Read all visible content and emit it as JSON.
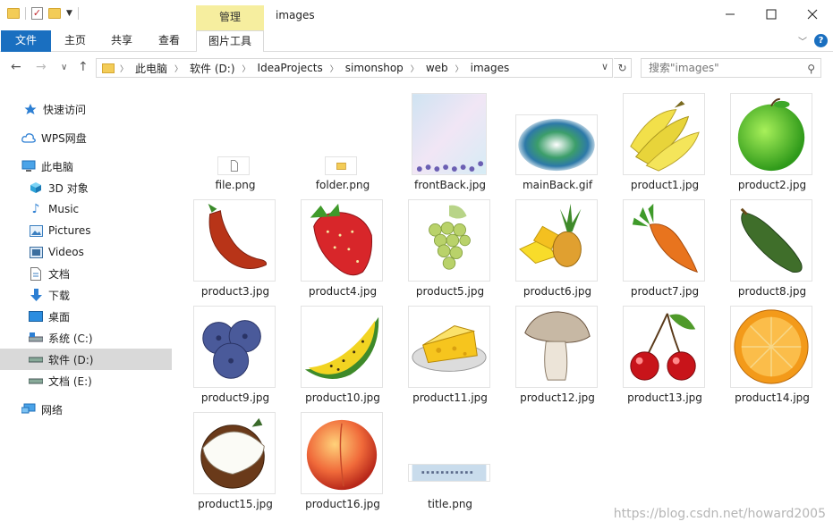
{
  "window": {
    "title": "images",
    "manage_tab": "管理"
  },
  "ribbon": {
    "tabs": [
      {
        "label": "文件"
      },
      {
        "label": "主页"
      },
      {
        "label": "共享"
      },
      {
        "label": "查看"
      },
      {
        "label": "图片工具"
      }
    ]
  },
  "address": {
    "crumbs": [
      "此电脑",
      "软件 (D:)",
      "IdeaProjects",
      "simonshop",
      "web",
      "images"
    ],
    "search_placeholder": "搜索\"images\""
  },
  "sidebar": {
    "items": [
      {
        "label": "快速访问",
        "icon": "star-icon"
      },
      {
        "label": "WPS网盘",
        "icon": "cloud-icon"
      },
      {
        "label": "此电脑",
        "icon": "computer-icon"
      },
      {
        "label": "3D 对象",
        "icon": "cube-icon"
      },
      {
        "label": "Music",
        "icon": "music-icon"
      },
      {
        "label": "Pictures",
        "icon": "pictures-icon"
      },
      {
        "label": "Videos",
        "icon": "videos-icon"
      },
      {
        "label": "文档",
        "icon": "document-icon"
      },
      {
        "label": "下载",
        "icon": "download-icon"
      },
      {
        "label": "桌面",
        "icon": "desktop-icon"
      },
      {
        "label": "系统 (C:)",
        "icon": "drive-c-icon"
      },
      {
        "label": "软件 (D:)",
        "icon": "drive-d-icon"
      },
      {
        "label": "文档 (E:)",
        "icon": "drive-e-icon"
      },
      {
        "label": "网络",
        "icon": "network-icon"
      }
    ],
    "selected_label": "软件 (D:)"
  },
  "files": [
    {
      "name": "file.png"
    },
    {
      "name": "folder.png"
    },
    {
      "name": "frontBack.jpg"
    },
    {
      "name": "mainBack.gif"
    },
    {
      "name": "product1.jpg"
    },
    {
      "name": "product2.jpg"
    },
    {
      "name": "product3.jpg"
    },
    {
      "name": "product4.jpg"
    },
    {
      "name": "product5.jpg"
    },
    {
      "name": "product6.jpg"
    },
    {
      "name": "product7.jpg"
    },
    {
      "name": "product8.jpg"
    },
    {
      "name": "product9.jpg"
    },
    {
      "name": "product10.jpg"
    },
    {
      "name": "product11.jpg"
    },
    {
      "name": "product12.jpg"
    },
    {
      "name": "product13.jpg"
    },
    {
      "name": "product14.jpg"
    },
    {
      "name": "product15.jpg"
    },
    {
      "name": "product16.jpg"
    },
    {
      "name": "title.png"
    }
  ],
  "watermark": "https://blog.csdn.net/howard2005",
  "colors": {
    "accent": "#1a6fc0",
    "manage_tab": "#f6ee9f",
    "selection": "#d9d9d9"
  }
}
